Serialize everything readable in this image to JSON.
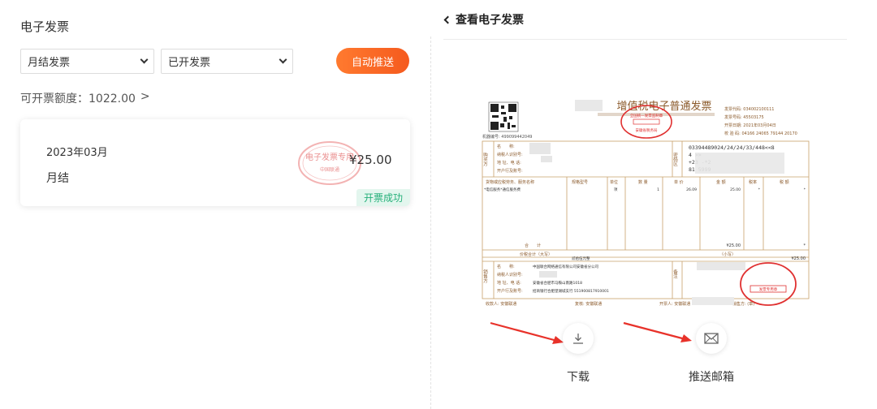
{
  "left": {
    "title": "电子发票",
    "filter_type": "月结发票",
    "filter_status": "已开发票",
    "auto_push_label": "自动推送",
    "quota_label": "可开票额度：1022.00",
    "quota_arrow": ">"
  },
  "invoice_card": {
    "month": "2023年03月",
    "type": "月结",
    "amount": "¥25.00",
    "status": "开票成功",
    "stamp_text": "电子发票专用",
    "stamp_sub": "中国联通"
  },
  "right": {
    "back_title": "查看电子发票",
    "download_label": "下载",
    "email_label": "推送邮箱"
  },
  "invoice": {
    "title": "增值税电子普通发票",
    "code_label": "发票代码: 034002100111",
    "number_label": "发票号码: 45503175",
    "date_label": "开票日期: 2021年03月04日",
    "check_label": "校 验 码: 04166 24065 79144 20170",
    "machine_no": "机器编号: 499099442049",
    "buyer_side": "购买方",
    "buyer_name": "名　　称:",
    "buyer_tax": "纳税人识别号:",
    "buyer_addr": "地 址、电 话:",
    "buyer_bank": "开户行及账号:",
    "cipher_side": "密码区",
    "cipher_1": "03394489024/24/24/33/448<<8",
    "cipher_2": "4                              >>",
    "cipher_3": "+23                           -*2",
    "cipher_4": "81                          5999",
    "col_item": "货物或应税劳务、服务名称",
    "col_spec": "规格型号",
    "col_unit": "单位",
    "col_qty": "数 量",
    "col_price": "单 价",
    "col_amount": "金 额",
    "col_rate": "税率",
    "col_tax": "税 额",
    "item_name": "*电信服务*通信服务费",
    "item_unit": "项",
    "item_qty": "1",
    "item_price": "26.09",
    "item_amount": "25.00",
    "item_rate": "*",
    "item_tax": "*",
    "sum_label": "合　　计",
    "sum_amount": "¥25.00",
    "sum_tax": "*",
    "total_label": "价税合计（大写）",
    "total_words": "贰拾伍元整",
    "total_small_label": "（小写）",
    "total_small": "¥25.00",
    "seller_side": "销售方",
    "seller_name": "中国联合网络通信有限公司安徽省分公司",
    "seller_addr": "安徽省合肥市马鞍山南路1018",
    "seller_bank": "招商银行合肥望湖城支行 551900817910001",
    "remark_side": "备注",
    "payee": "收款人: 安徽联通",
    "reviewer": "复核: 安徽联通",
    "drawer": "开票人: 安徽联通",
    "seller_sign": "销售方: (章)",
    "stamp_top": "全国统一发票监制章",
    "stamp_bottom": "安徽省税务局",
    "seller_stamp": "发票专用章"
  },
  "colors": {
    "accent": "#f55a1e",
    "success_bg": "#e3f6ee",
    "success_text": "#26b07a",
    "invoice_ink": "#8b5a2b",
    "stamp_red": "#e03030",
    "annotation_red": "#e8322a"
  }
}
